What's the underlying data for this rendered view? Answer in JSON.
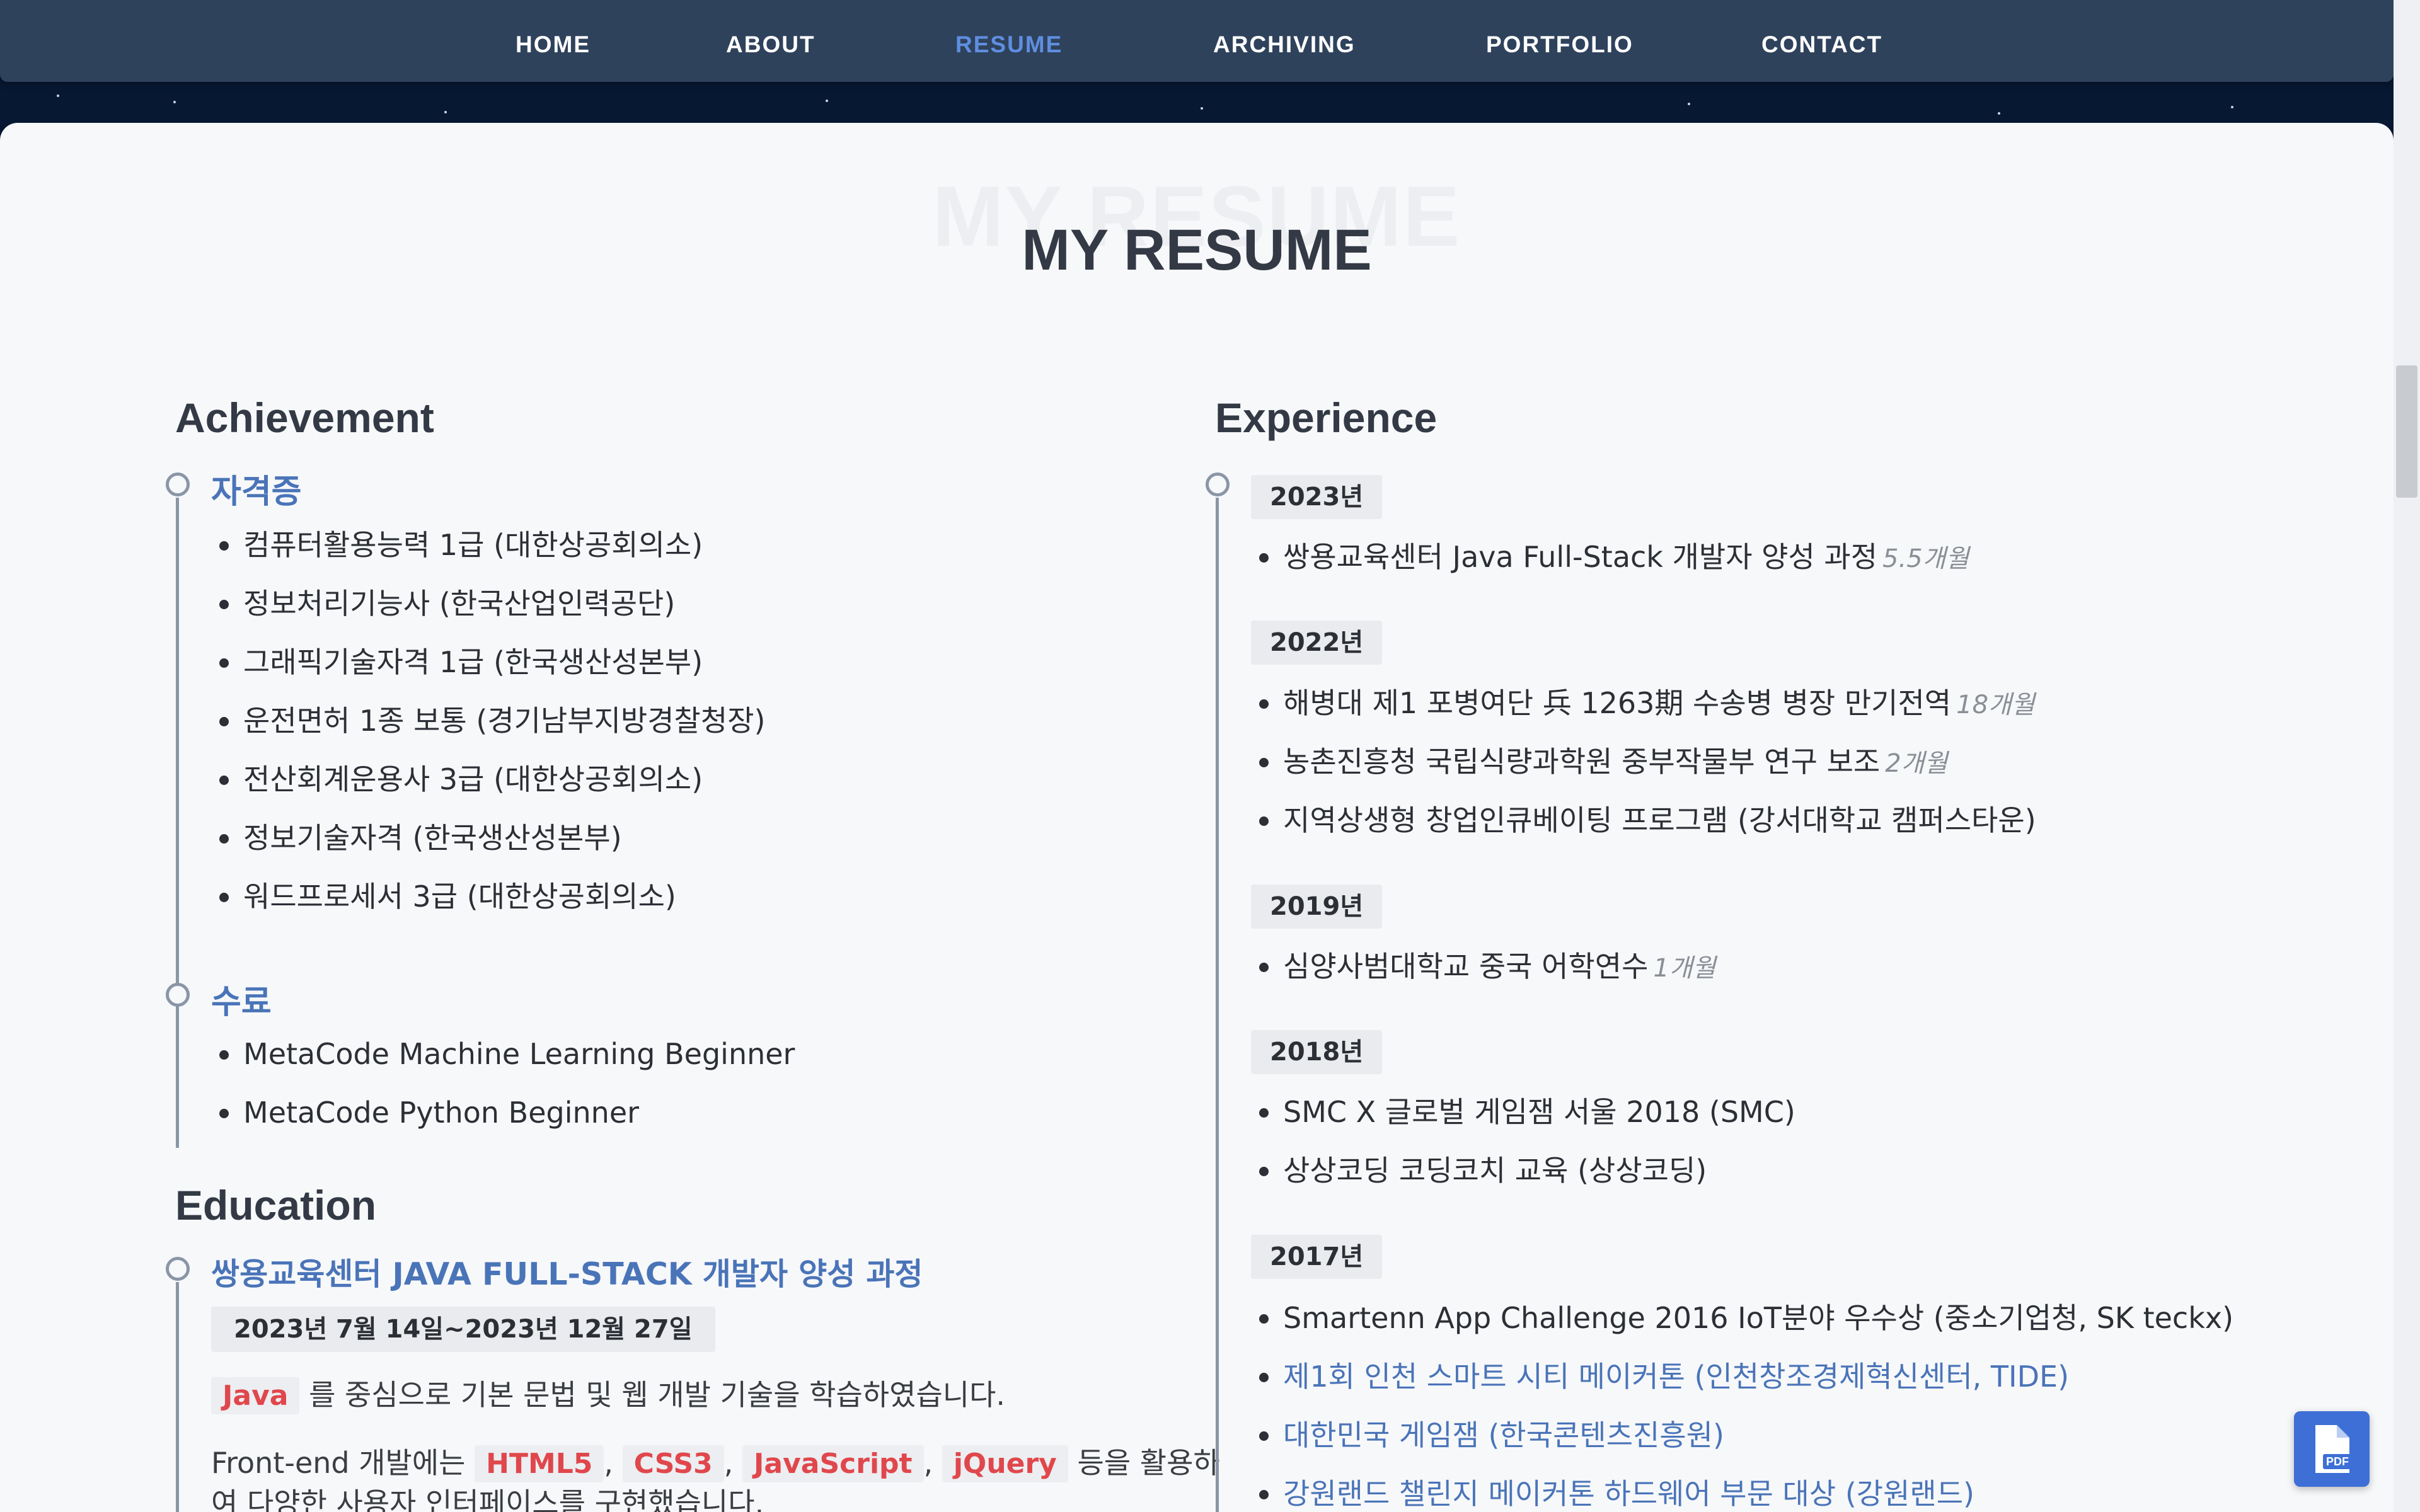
{
  "nav": {
    "items": [
      {
        "label": "HOME",
        "active": false
      },
      {
        "label": "ABOUT",
        "active": false
      },
      {
        "label": "RESUME",
        "active": true
      },
      {
        "label": "ARCHIVING",
        "active": false
      },
      {
        "label": "PORTFOLIO",
        "active": false
      },
      {
        "label": "CONTACT",
        "active": false
      }
    ],
    "active_color": "#5f8ee0"
  },
  "page": {
    "title": "MY RESUME",
    "title_ghost": "MY RESUME"
  },
  "achievement": {
    "heading": "Achievement",
    "groups": [
      {
        "title": "자격증",
        "items": [
          "컴퓨터활용능력 1급 (대한상공회의소)",
          "정보처리기능사 (한국산업인력공단)",
          "그래픽기술자격 1급 (한국생산성본부)",
          "운전면허 1종 보통 (경기남부지방경찰청장)",
          "전산회계운용사 3급 (대한상공회의소)",
          "정보기술자격 (한국생산성본부)",
          "워드프로세서 3급 (대한상공회의소)"
        ]
      },
      {
        "title": "수료",
        "items": [
          "MetaCode Machine Learning Beginner",
          "MetaCode Python Beginner"
        ]
      }
    ]
  },
  "education": {
    "heading": "Education",
    "title": "쌍용교육센터 JAVA FULL-STACK 개발자 양성 과정",
    "date": "2023년 7월 14일~2023년 12월 27일",
    "line1_code": "Java",
    "line1_text": "를 중심으로 기본 문법 및 웹 개발 기술을 학습하였습니다.",
    "line2_prefix": "Front-end 개발에는",
    "line2_codes": [
      "HTML5",
      "CSS3",
      "JavaScript",
      "jQuery"
    ],
    "line2_sep": ",",
    "line2_suffix": "등을 활용하",
    "line3_text": "여 다양한 사용자 인터페이스를 구현했습니다."
  },
  "experience": {
    "heading": "Experience",
    "years": [
      {
        "year": "2023년",
        "items": [
          {
            "text": "쌍용교육센터 Java Full-Stack 개발자 양성 과정",
            "duration": "5.5개월",
            "link": false
          }
        ]
      },
      {
        "year": "2022년",
        "items": [
          {
            "text": "해병대 제1 포병여단 兵 1263期 수송병 병장 만기전역",
            "duration": "18개월",
            "link": false
          },
          {
            "text": "농촌진흥청 국립식량과학원 중부작물부 연구 보조",
            "duration": "2개월",
            "link": false
          },
          {
            "text": "지역상생형 창업인큐베이팅 프로그램 (강서대학교 캠퍼스타운)",
            "duration": "",
            "link": false
          }
        ]
      },
      {
        "year": "2019년",
        "items": [
          {
            "text": "심양사범대학교 중국 어학연수",
            "duration": "1개월",
            "link": false
          }
        ]
      },
      {
        "year": "2018년",
        "items": [
          {
            "text": "SMC X 글로벌 게임잼 서울 2018 (SMC)",
            "duration": "",
            "link": false
          },
          {
            "text": "상상코딩 코딩코치 교육 (상상코딩)",
            "duration": "",
            "link": false
          }
        ]
      },
      {
        "year": "2017년",
        "items": [
          {
            "text": "Smartenn App Challenge 2016 IoT분야 우수상 (중소기업청, SK teckx)",
            "duration": "",
            "link": false
          },
          {
            "text": "제1회 인천 스마트 시티 메이커톤 (인천창조경제혁신센터, TIDE)",
            "duration": "",
            "link": true
          },
          {
            "text": "대한민국 게임잼 (한국콘텐츠진흥원)",
            "duration": "",
            "link": true
          },
          {
            "text": "강원랜드 챌린지 메이커톤 하드웨어 부문 대상 (강원랜드)",
            "duration": "",
            "link": true
          }
        ]
      }
    ]
  },
  "pdf_button": {
    "label": "PDF",
    "icon": "pdf-file-icon"
  }
}
